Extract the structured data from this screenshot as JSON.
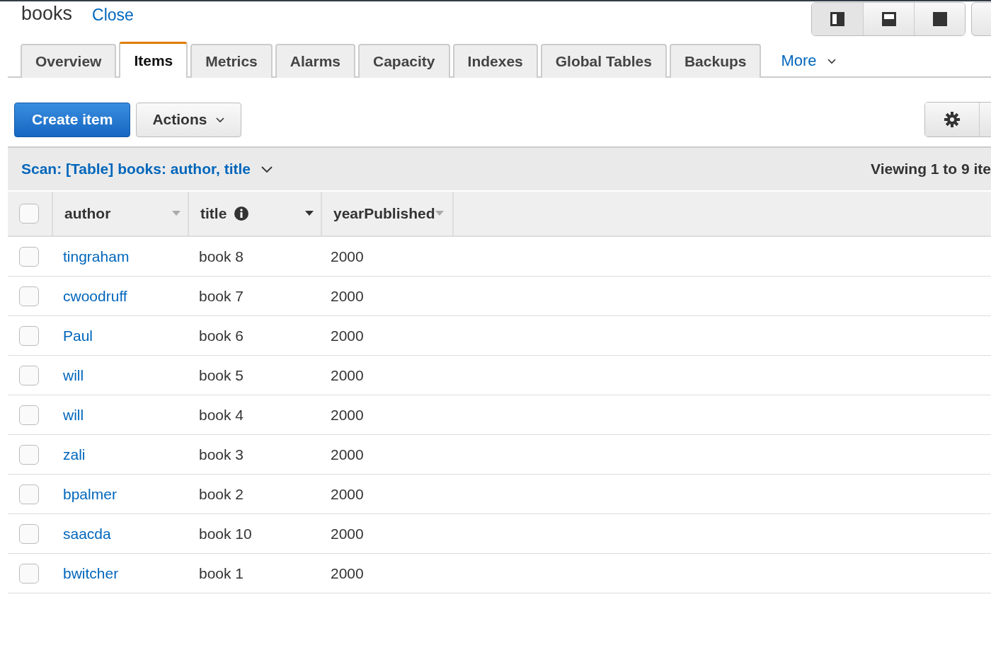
{
  "header": {
    "title": "books",
    "close_link": "Close"
  },
  "tabs": [
    {
      "label": "Overview",
      "selected": false
    },
    {
      "label": "Items",
      "selected": true
    },
    {
      "label": "Metrics",
      "selected": false
    },
    {
      "label": "Alarms",
      "selected": false
    },
    {
      "label": "Capacity",
      "selected": false
    },
    {
      "label": "Indexes",
      "selected": false
    },
    {
      "label": "Global Tables",
      "selected": false
    },
    {
      "label": "Backups",
      "selected": false
    }
  ],
  "more_menu": "More",
  "toolbar": {
    "primary_button": "Create item",
    "actions_button": "Actions"
  },
  "scan_bar": {
    "query": "Scan: [Table] books: author, title",
    "count": "Viewing 1 to 9 ite"
  },
  "table": {
    "columns": [
      {
        "label": "author",
        "info": false
      },
      {
        "label": "title",
        "info": true
      },
      {
        "label": "yearPublished",
        "info": false
      }
    ],
    "select_all_checked": false,
    "rows": [
      {
        "checked": false,
        "author": "tingraham",
        "title": "book 8",
        "year": "2000"
      },
      {
        "checked": false,
        "author": "cwoodruff",
        "title": "book 7",
        "year": "2000"
      },
      {
        "checked": false,
        "author": "Paul",
        "title": "book 6",
        "year": "2000"
      },
      {
        "checked": false,
        "author": "will",
        "title": "book 5",
        "year": "2000"
      },
      {
        "checked": false,
        "author": "will",
        "title": "book 4",
        "year": "2000"
      },
      {
        "checked": false,
        "author": "zali",
        "title": "book 3",
        "year": "2000"
      },
      {
        "checked": false,
        "author": "bpalmer",
        "title": "book 2",
        "year": "2000"
      },
      {
        "checked": false,
        "author": "saacda",
        "title": "book 10",
        "year": "2000"
      },
      {
        "checked": false,
        "author": "bwitcher",
        "title": "book 1",
        "year": "2000"
      }
    ]
  }
}
